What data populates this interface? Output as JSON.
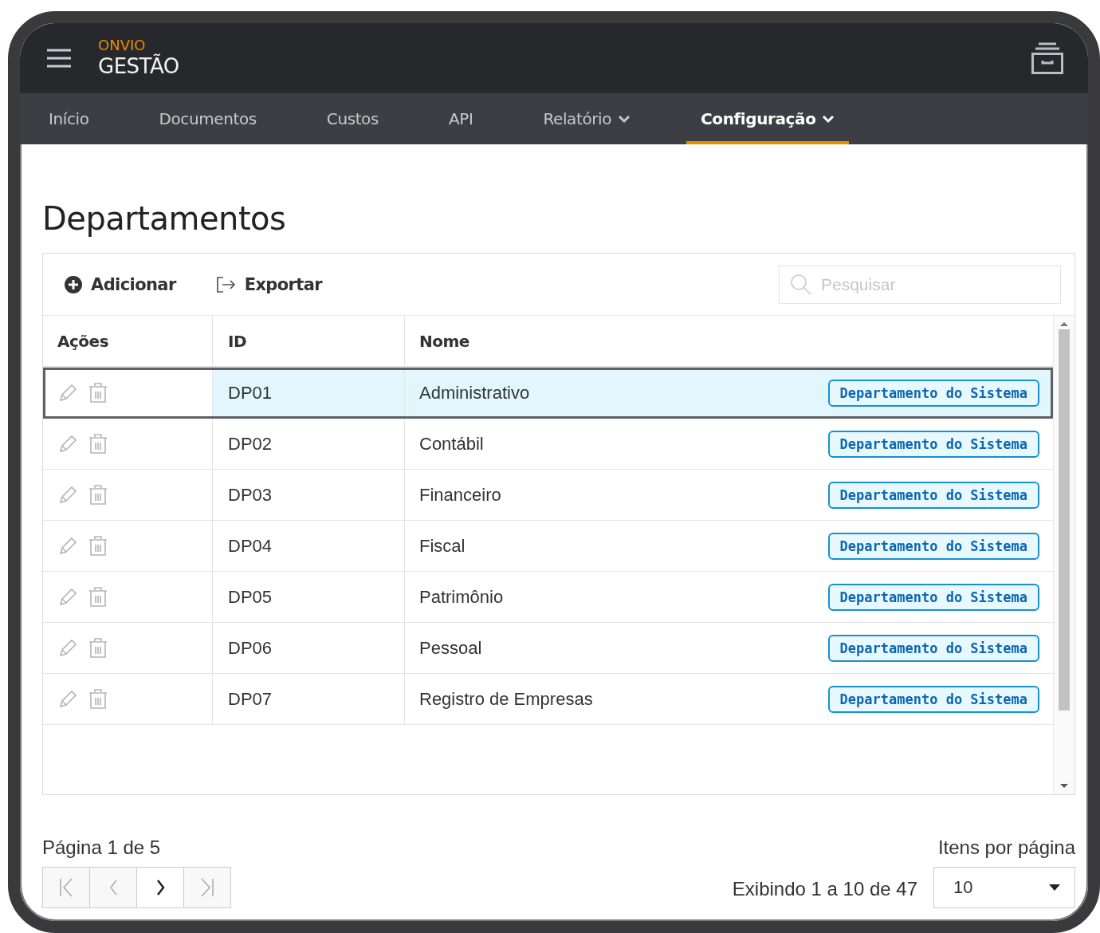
{
  "header": {
    "brand": "ONVIO",
    "product": "GESTÃO"
  },
  "nav": [
    {
      "label": "Início",
      "selected": false,
      "dropdown": false
    },
    {
      "label": "Documentos",
      "selected": false,
      "dropdown": false
    },
    {
      "label": "Custos",
      "selected": false,
      "dropdown": false
    },
    {
      "label": "API",
      "selected": false,
      "dropdown": false
    },
    {
      "label": "Relatório",
      "selected": false,
      "dropdown": true
    },
    {
      "label": "Configuração",
      "selected": true,
      "dropdown": true
    }
  ],
  "page_title": "Departamentos",
  "toolbar": {
    "add": "Adicionar",
    "export": "Exportar",
    "search": {
      "placeholder": "Pesquisar"
    }
  },
  "table": {
    "columns": [
      "Ações",
      "ID",
      "Nome"
    ],
    "rows": [
      {
        "id": "DP01",
        "name": "Administrativo",
        "tag": "Departamento do Sistema",
        "selected": true
      },
      {
        "id": "DP02",
        "name": "Contábil",
        "tag": "Departamento do Sistema",
        "selected": false
      },
      {
        "id": "DP03",
        "name": "Financeiro",
        "tag": "Departamento do Sistema",
        "selected": false
      },
      {
        "id": "DP04",
        "name": "Fiscal",
        "tag": "Departamento do Sistema",
        "selected": false
      },
      {
        "id": "DP05",
        "name": "Patrimônio",
        "tag": "Departamento do Sistema",
        "selected": false
      },
      {
        "id": "DP06",
        "name": "Pessoal",
        "tag": "Departamento do Sistema",
        "selected": false
      },
      {
        "id": "DP07",
        "name": "Registro de Empresas",
        "tag": "Departamento do Sistema",
        "selected": false
      }
    ]
  },
  "pager": {
    "page_info": "Página 1 de 5",
    "buttons": [
      {
        "kind": "first",
        "disabled": true
      },
      {
        "kind": "prev",
        "disabled": true
      },
      {
        "kind": "next",
        "disabled": false
      },
      {
        "kind": "last",
        "disabled": true
      }
    ],
    "range": "Exibindo 1 a 10 de 47",
    "per_page_label": "Itens por página",
    "per_page": "10"
  }
}
